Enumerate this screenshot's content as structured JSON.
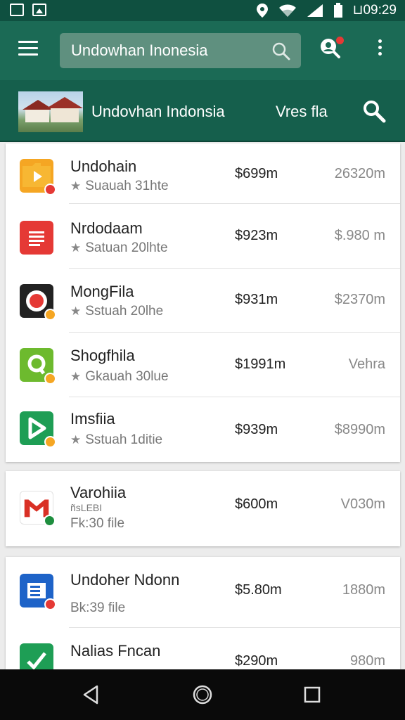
{
  "status_bar": {
    "time": "⊔09:29",
    "left_icons": [
      "image-icon",
      "photo-icon"
    ],
    "right_icons": [
      "location-icon",
      "wifi-icon",
      "signal-icon",
      "battery-icon"
    ]
  },
  "app_bar": {
    "search_value": "Undowhan Inonesia",
    "search_placeholder": "Undowhan Inonesia",
    "accent": "#1b6a55",
    "notification_dot_color": "#e53935"
  },
  "sub_bar": {
    "title": "Undovhan Indonsia",
    "link": "Vres fla"
  },
  "cards": [
    {
      "rows": [
        {
          "title": "Undohain",
          "subtitle": "Suauah 31hte",
          "price": "$699m",
          "size": "26320m",
          "icon": "folder-play-icon",
          "icon_color": "#f5a623",
          "badge_color": "#e53935"
        },
        {
          "title": "Nrdodaam",
          "subtitle": "Satuan 20lhte",
          "price": "$923m",
          "size": "$.980 m",
          "icon": "document-icon",
          "icon_color": "#e53935",
          "badge_color": ""
        },
        {
          "title": "MongFila",
          "subtitle": "Sstuah 20lhe",
          "price": "$931m",
          "size": "$2370m",
          "icon": "record-icon",
          "icon_color": "#222222",
          "badge_color": "#f5a623"
        },
        {
          "title": "Shogfhila",
          "subtitle": "Gkauah 30lue",
          "price": "$1991m",
          "size": "Vehra",
          "icon": "map-pin-icon",
          "icon_color": "#6dba2e",
          "badge_color": "#f5a623"
        },
        {
          "title": "Imsfiia",
          "subtitle": "Sstuah 1ditie",
          "price": "$939m",
          "size": "$8990m",
          "icon": "play-icon",
          "icon_color": "#1e9e55",
          "badge_color": "#f5a623"
        }
      ]
    },
    {
      "rows": [
        {
          "title": "Varohiia",
          "subtitle_small": "ñsLEBI",
          "subtitle": "Fk:30 file",
          "price": "$600m",
          "size": "V030m",
          "icon": "gmail-icon",
          "icon_color": "#d93025",
          "badge_color": "#1e8e3e"
        }
      ]
    },
    {
      "rows": [
        {
          "title": "Undoher Ndonn",
          "subtitle": "Bk:39 file",
          "price": "$5.80m",
          "size": "1880m",
          "icon": "list-doc-icon",
          "icon_color": "#1e63c8",
          "badge_color": "#e53935"
        },
        {
          "title": "Nalias Fncan",
          "subtitle": "",
          "price": "$290m",
          "size": "980m",
          "icon": "check-edit-icon",
          "icon_color": "#1e9e55",
          "badge_color": ""
        }
      ]
    }
  ],
  "nav_bar": {
    "buttons": [
      "back-icon",
      "home-icon",
      "recents-icon"
    ]
  }
}
